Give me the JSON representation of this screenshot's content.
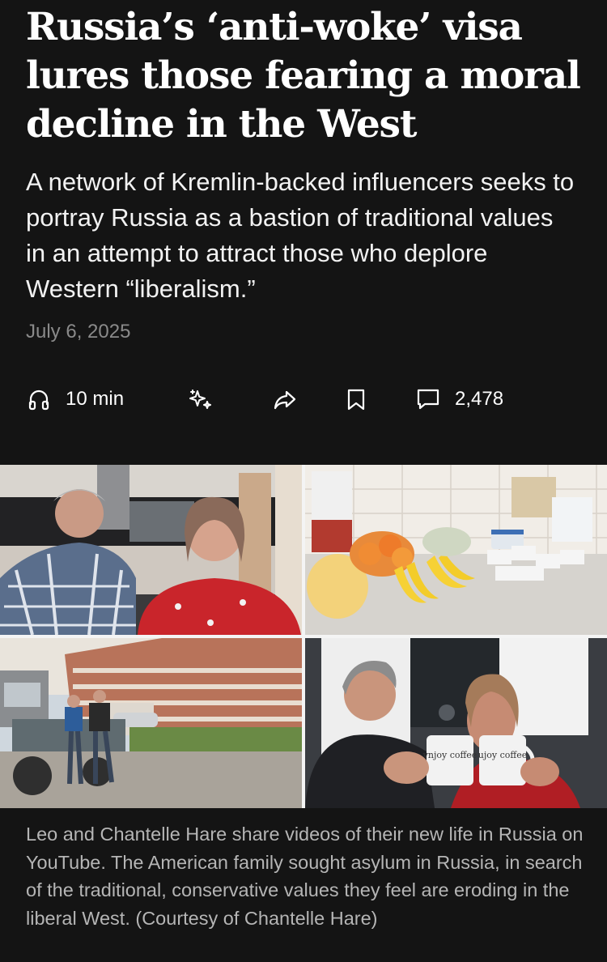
{
  "article": {
    "headline": "Russia’s ‘anti-woke’ visa lures those fearing a moral decline in the West",
    "dek": "A network of Kremlin-backed influencers seeks to portray Russia as a bastion of traditional values in an attempt to attract those who deplore Western “liberalism.”",
    "date": "July 6, 2025"
  },
  "toolbar": {
    "listen": {
      "icon": "headphones-icon",
      "label": "10 min"
    },
    "ai_summary": {
      "icon": "sparkles-icon"
    },
    "share": {
      "icon": "share-arrow-icon"
    },
    "save": {
      "icon": "bookmark-icon"
    },
    "comments": {
      "icon": "comment-icon",
      "count": "2,478"
    }
  },
  "photo": {
    "mug_text_left": "vnjoy coffee",
    "mug_text_right": "ujoy coffee",
    "caption": "Leo and Chantelle Hare share videos of their new life in Russia on YouTube. The American family sought asylum in Russia, in search of the traditional, conservative values they feel are eroding in the liberal West. (Courtesy of Chantelle Hare)"
  },
  "colors": {
    "background": "#141414",
    "headline": "#ffffff",
    "dek": "#f2f2f2",
    "date": "#8a8a8a",
    "caption": "#b5b5b5"
  }
}
